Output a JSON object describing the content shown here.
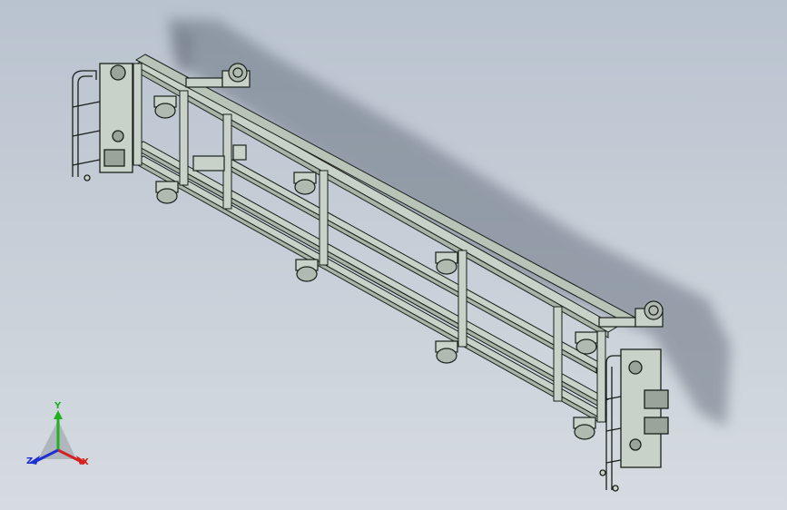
{
  "viewport": {
    "background_top": "#b9c3cf",
    "background_bottom": "#d6dbe1",
    "model_color": "#c8d2c8",
    "edge_color": "#1a1f1a"
  },
  "triad": {
    "x_label": "X",
    "y_label": "Y",
    "z_label": "Z",
    "x_color": "#d42020",
    "y_color": "#20b020",
    "z_color": "#2030d0"
  }
}
